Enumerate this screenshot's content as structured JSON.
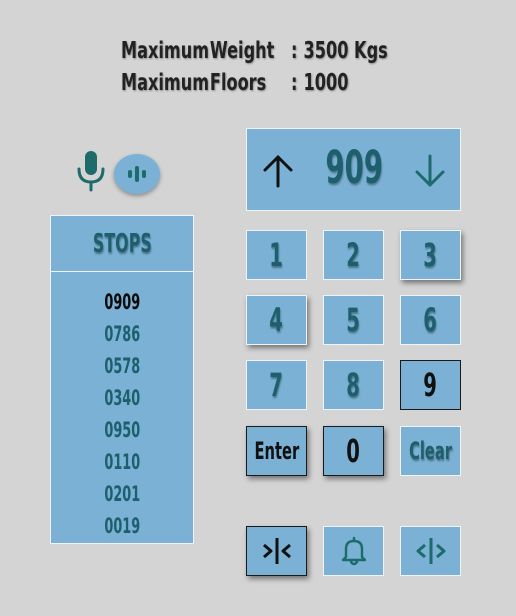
{
  "info": {
    "max_weight": {
      "label1": "Maximum",
      "label2": "Weight",
      "colon": ":",
      "value": "3500 Kgs"
    },
    "max_floors": {
      "label1": "Maximum",
      "label2": "Floors",
      "colon": ":",
      "value": "1000"
    }
  },
  "icons": {
    "mic": "microphone-icon",
    "voice": "voice-wave-icon",
    "up": "arrow-up-icon",
    "down": "arrow-down-icon",
    "close": "close-doors-icon",
    "bell": "bell-icon",
    "open": "open-doors-icon"
  },
  "stops": {
    "title": "STOPS",
    "items": [
      "0909",
      "0786",
      "0578",
      "0340",
      "0950",
      "0110",
      "0201",
      "0019"
    ]
  },
  "display": {
    "floor": "909"
  },
  "keypad": {
    "k1": "1",
    "k2": "2",
    "k3": "3",
    "k4": "4",
    "k5": "5",
    "k6": "6",
    "k7": "7",
    "k8": "8",
    "k9": "9",
    "enter": "Enter",
    "k0": "0",
    "clear": "Clear"
  },
  "colors": {
    "panel": "#7ab1d4",
    "text": "#1d5f6c",
    "background": "#d4d4d4"
  }
}
